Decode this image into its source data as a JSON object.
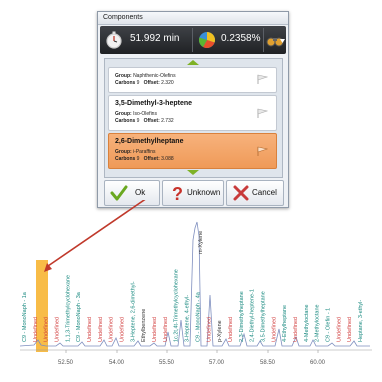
{
  "dialog": {
    "title": "Components",
    "toolbar": {
      "time_value": "51.992 min",
      "percent_value": "0.2358%",
      "stopwatch_icon": "stopwatch-icon",
      "pie_icon": "pie-chart-icon",
      "binoculars_icon": "binoculars-icon",
      "dropdown_icon": "chevron-down-icon"
    },
    "components": [
      {
        "name": "",
        "group_label": "Group:",
        "group": "Naphthenic-Olefins",
        "carbons_label": "Carbons",
        "carbons": "9",
        "offset_label": "Offset:",
        "offset": "2.320",
        "selected": false
      },
      {
        "name": "3,5-Dimethyl-3-heptene",
        "group_label": "Group:",
        "group": "Iso-Olefins",
        "carbons_label": "Carbons",
        "carbons": "9",
        "offset_label": "Offset:",
        "offset": "2.732",
        "selected": false
      },
      {
        "name": "2,6-Dimethylheptane",
        "group_label": "Group:",
        "group": "i-Paraffins",
        "carbons_label": "Carbons",
        "carbons": "9",
        "offset_label": "Offset:",
        "offset": "3.088",
        "selected": true
      }
    ],
    "buttons": {
      "ok": "Ok",
      "unknown": "Unknown",
      "cancel": "Cancel"
    },
    "colors": {
      "selected": "#f0a060",
      "ok_green": "#6aa820",
      "unknown_red": "#c8322a",
      "cancel_red": "#c83a3a"
    }
  },
  "chromatogram": {
    "ticks": [
      "52.50",
      "54.00",
      "55.50",
      "57.00",
      "58.50",
      "60.00"
    ],
    "top_peak_label": "m-Xylene",
    "highlight_label": "Undefined",
    "labels": [
      {
        "text": "C9 - MonoNaph - 1a",
        "color": "#1a8a80"
      },
      {
        "text": "Undefined",
        "color": "#d24040"
      },
      {
        "text": "Undefined",
        "color": "#d24040"
      },
      {
        "text": "Undefined",
        "color": "#d24040"
      },
      {
        "text": "1,1,3-Trimethylcyclohexane",
        "color": "#1a8a80"
      },
      {
        "text": "C9 - MonoNaph - 3a",
        "color": "#1a8a80"
      },
      {
        "text": "Undefined",
        "color": "#d24040"
      },
      {
        "text": "Undefined",
        "color": "#d24040"
      },
      {
        "text": "Undefined",
        "color": "#d24040"
      },
      {
        "text": "Undefined",
        "color": "#d24040"
      },
      {
        "text": "3-Heptene, 2,6-dimethyl-",
        "color": "#1a8a80"
      },
      {
        "text": "Ethylbenzene",
        "color": "#333333"
      },
      {
        "text": "Undefined",
        "color": "#d24040"
      },
      {
        "text": "Undefined",
        "color": "#d24040"
      },
      {
        "text": "1c,2t,4t-Trimethylcyclohexane",
        "color": "#1a8a80"
      },
      {
        "text": "3-Heptene, 4-ethyl-",
        "color": "#1a8a80"
      },
      {
        "text": "C9 - MonoNaph - 4a",
        "color": "#1a8a80"
      },
      {
        "text": "Undefined",
        "color": "#d24040"
      },
      {
        "text": "p-Xylene",
        "color": "#333333"
      },
      {
        "text": "Undefined",
        "color": "#d24040"
      },
      {
        "text": "2,3-Dimethylheptane",
        "color": "#1a8a80"
      },
      {
        "text": "2,4-Diethyl-heptene-1",
        "color": "#1a8a80"
      },
      {
        "text": "3,5-Dimethylheptane",
        "color": "#1a8a80"
      },
      {
        "text": "Undefined",
        "color": "#d24040"
      },
      {
        "text": "4-Ethylheptane",
        "color": "#1a8a80"
      },
      {
        "text": "Undefined",
        "color": "#d24040"
      },
      {
        "text": "4-Methyloctane",
        "color": "#1a8a80"
      },
      {
        "text": "2-Methyloctane",
        "color": "#1a8a80"
      },
      {
        "text": "C9 - Olefin - 1",
        "color": "#1a8a80"
      },
      {
        "text": "Undefined",
        "color": "#d24040"
      },
      {
        "text": "Undefined",
        "color": "#d24040"
      },
      {
        "text": "Heptane, 3-ethyl-",
        "color": "#1a8a80"
      }
    ],
    "colors": {
      "trace": "#7f8fbf",
      "highlight": "#f7b027",
      "arrow": "#c0392b"
    }
  }
}
